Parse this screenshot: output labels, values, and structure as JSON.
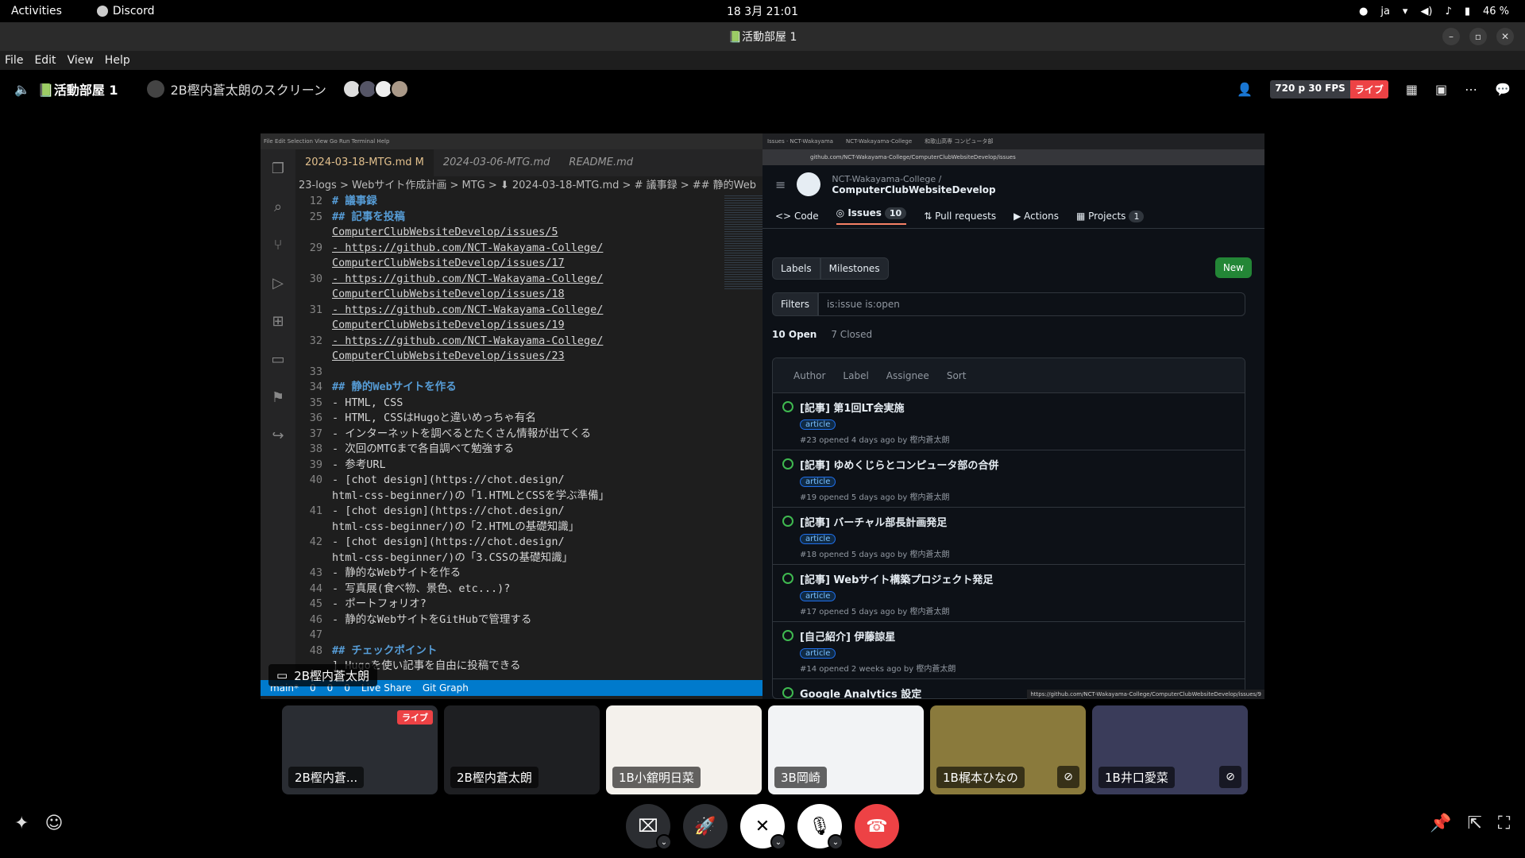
{
  "system_bar": {
    "activities": "Activities",
    "app_name": "Discord",
    "clock": "18 3月  21:01",
    "input_method": "ja",
    "battery": "46 %"
  },
  "window": {
    "title": "📗活動部屋 1"
  },
  "menu": [
    "File",
    "Edit",
    "View",
    "Help"
  ],
  "call_header": {
    "channel": "📗活動部屋 1",
    "stream_title": "2B樫内蒼太朗のスクリーン",
    "quality": "720 p 30 FPS",
    "live": "ライブ"
  },
  "vscode": {
    "tabs": [
      {
        "label": "2024-03-18-MTG.md M",
        "active": true
      },
      {
        "label": "2024-03-06-MTG.md",
        "active": false
      },
      {
        "label": "README.md",
        "active": false
      }
    ],
    "breadcrumb": "23-logs > Webサイト作成計画 > MTG > ⬇ 2024-03-18-MTG.md > # 議事録 > ## 静的Web",
    "lines": [
      {
        "n": "12",
        "t": "# 議事録",
        "h": true
      },
      {
        "n": "25",
        "t": "## 記事を投稿",
        "h": true
      },
      {
        "n": "",
        "t": "ComputerClubWebsiteDevelop/issues/5",
        "link": true
      },
      {
        "n": "29",
        "t": "- https://github.com/NCT-Wakayama-College/",
        "link": true
      },
      {
        "n": "",
        "t": "ComputerClubWebsiteDevelop/issues/17",
        "link": true
      },
      {
        "n": "30",
        "t": "- https://github.com/NCT-Wakayama-College/",
        "link": true
      },
      {
        "n": "",
        "t": "ComputerClubWebsiteDevelop/issues/18",
        "link": true
      },
      {
        "n": "31",
        "t": "- https://github.com/NCT-Wakayama-College/",
        "link": true
      },
      {
        "n": "",
        "t": "ComputerClubWebsiteDevelop/issues/19",
        "link": true
      },
      {
        "n": "32",
        "t": "- https://github.com/NCT-Wakayama-College/",
        "link": true
      },
      {
        "n": "",
        "t": "ComputerClubWebsiteDevelop/issues/23",
        "link": true
      },
      {
        "n": "33",
        "t": ""
      },
      {
        "n": "34",
        "t": "## 静的Webサイトを作る",
        "h": true
      },
      {
        "n": "35",
        "t": "- HTML, CSS"
      },
      {
        "n": "36",
        "t": "  - HTML, CSSはHugoと違いめっちゃ有名"
      },
      {
        "n": "37",
        "t": "  - インターネットを調べるとたくさん情報が出てくる"
      },
      {
        "n": "38",
        "t": "  - 次回のMTGまで各自調べて勉強する"
      },
      {
        "n": "39",
        "t": "  - 参考URL"
      },
      {
        "n": "40",
        "t": "  - [chot design](https://chot.design/"
      },
      {
        "n": "",
        "t": "  html-css-beginner/)の「1.HTMLとCSSを学ぶ準備」"
      },
      {
        "n": "41",
        "t": "  - [chot design](https://chot.design/"
      },
      {
        "n": "",
        "t": "  html-css-beginner/)の「2.HTMLの基礎知識」"
      },
      {
        "n": "42",
        "t": "  - [chot design](https://chot.design/"
      },
      {
        "n": "",
        "t": "  html-css-beginner/)の「3.CSSの基礎知識」"
      },
      {
        "n": "43",
        "t": "- 静的なWebサイトを作る"
      },
      {
        "n": "44",
        "t": "  - 写真展(食べ物、景色、etc...)?"
      },
      {
        "n": "45",
        "t": "  - ポートフォリオ?"
      },
      {
        "n": "46",
        "t": "- 静的なWebサイトをGitHubで管理する"
      },
      {
        "n": "47",
        "t": ""
      },
      {
        "n": "48",
        "t": "## チェックポイント",
        "h": true
      },
      {
        "n": "",
        "t": "] Hugoを使い記事を自由に投稿できる"
      }
    ],
    "status": {
      "branch": "main*",
      "errors": "0",
      "warnings": "0",
      "ports": "0",
      "live_share": "Live Share",
      "git_graph": "Git Graph"
    },
    "presenter_overlay": "2B樫内蒼太朗"
  },
  "github": {
    "url": "github.com/NCT-Wakayama-College/ComputerClubWebsiteDevelop/issues",
    "owner": "NCT-Wakayama-College /",
    "repo": "ComputerClubWebsiteDevelop",
    "nav": {
      "code": "Code",
      "issues": "Issues",
      "issues_count": "10",
      "pulls": "Pull requests",
      "actions": "Actions",
      "projects": "Projects",
      "projects_count": "1"
    },
    "labels_btn": "Labels",
    "milestones_btn": "Milestones",
    "new_btn": "New",
    "filters_btn": "Filters",
    "search_value": "is:issue is:open",
    "open_count": "10 Open",
    "closed_count": "7 Closed",
    "list_filters": [
      "Author",
      "Label",
      "Assignee",
      "Sort"
    ],
    "issues": [
      {
        "title": "[記事] 第1回LT会実施",
        "label": "article",
        "meta": "#23 opened 4 days ago by 樫内蒼太朗"
      },
      {
        "title": "[記事] ゆめくじらとコンピュータ部の合併",
        "label": "article",
        "meta": "#19 opened 5 days ago by 樫内蒼太朗"
      },
      {
        "title": "[記事] バーチャル部長計画発足",
        "label": "article",
        "meta": "#18 opened 5 days ago by 樫内蒼太朗"
      },
      {
        "title": "[記事] Webサイト構築プロジェクト発足",
        "label": "article",
        "meta": "#17 opened 5 days ago by 樫内蒼太朗"
      },
      {
        "title": "[自己紹介] 伊藤諒星",
        "label": "article",
        "meta": "#14 opened 2 weeks ago by 樫内蒼太朗"
      },
      {
        "title": "Google Analytics 設定",
        "label": "",
        "meta": ""
      }
    ],
    "status_url": "https://github.com/NCT-Wakayama-College/ComputerClubWebsiteDevelop/issues/9"
  },
  "participants": [
    {
      "name": "2B樫内蒼...",
      "type": "stream",
      "badge": "ライブ",
      "bg": "#2a2d33"
    },
    {
      "name": "2B樫内蒼太朗",
      "type": "user",
      "bg": "#1e1f22"
    },
    {
      "name": "1B小舘明日菜",
      "type": "user",
      "bg": "#f4f1ec"
    },
    {
      "name": "3B岡崎",
      "type": "user",
      "bg": "#f2f3f5"
    },
    {
      "name": "1B梶本ひなの",
      "type": "user",
      "bg": "#8a7a3c",
      "muted": true
    },
    {
      "name": "1B井口愛菜",
      "type": "user",
      "bg": "#3a3c5a",
      "muted": true
    }
  ],
  "colors": {
    "live_red": "#ed4245",
    "vscode_blue": "#007acc",
    "github_green": "#238636"
  }
}
